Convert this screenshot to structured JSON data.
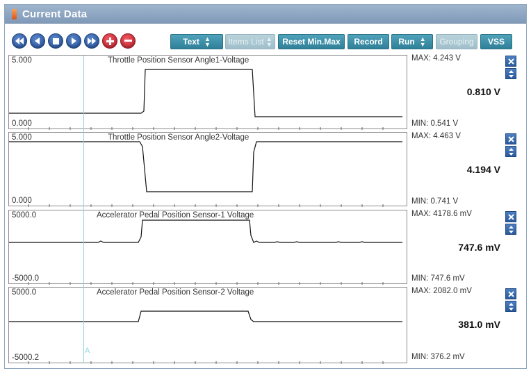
{
  "window": {
    "title": "Current Data"
  },
  "toolbar": {
    "nav_buttons": [
      "first-icon",
      "previous-icon",
      "stop-icon",
      "play-icon",
      "last-icon"
    ],
    "zoom_buttons": [
      "plus-icon",
      "minus-icon"
    ],
    "text_select": "Text",
    "items_list": "Items List",
    "reset_minmax": "Reset Min.Max",
    "record": "Record",
    "run_select": "Run",
    "grouping": "Grouping",
    "vss": "VSS"
  },
  "cursor": {
    "label": "A"
  },
  "charts": [
    {
      "title": "Throttle Position Sensor Angle1-Voltage",
      "y_top": "5.000",
      "y_bottom": "0.000",
      "max": "MAX: 4.243 V",
      "min": "MIN: 0.541 V",
      "value": "0.810 V"
    },
    {
      "title": "Throttle Position Sensor Angle2-Voltage",
      "y_top": "5.000",
      "y_bottom": "0.000",
      "max": "MAX: 4.463 V",
      "min": "MIN: 0.741 V",
      "value": "4.194 V"
    },
    {
      "title": "Accelerator Pedal Position Sensor-1 Voltage",
      "y_top": "5000.0",
      "y_bottom": "-5000.0",
      "max": "MAX: 4178.6 mV",
      "min": "MIN: 747.6 mV",
      "value": "747.6 mV"
    },
    {
      "title": "Accelerator Pedal Position Sensor-2 Voltage",
      "y_top": "5000.0",
      "y_bottom": "-5000.2",
      "max": "MAX: 2082.0 mV",
      "min": "MIN: 376.2 mV",
      "value": "381.0 mV"
    }
  ]
}
